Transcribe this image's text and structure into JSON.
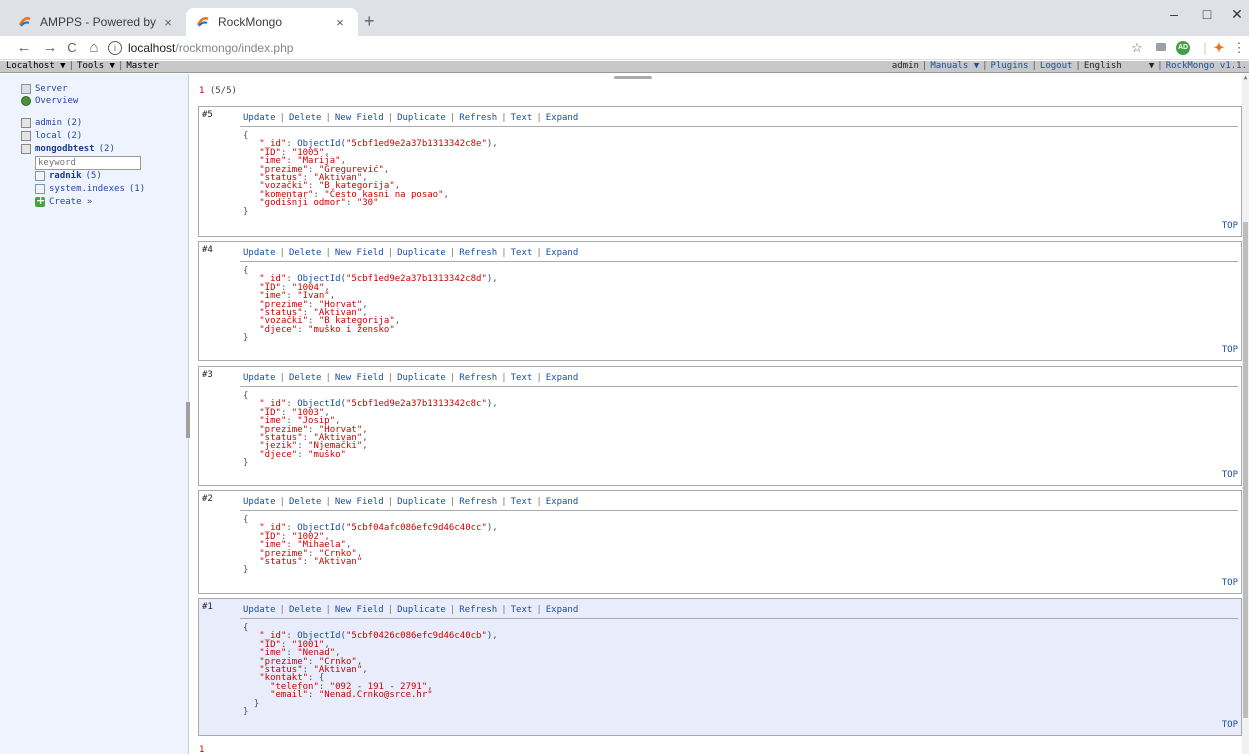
{
  "browser": {
    "tabs": [
      {
        "title": "AMPPS - Powered by Softaculous",
        "close": "×"
      },
      {
        "title": "RockMongo",
        "close": "×"
      }
    ],
    "new_tab": "+",
    "window": {
      "minimize": "–",
      "maximize": "□",
      "close": "✕"
    },
    "nav": {
      "back": "←",
      "forward": "→",
      "reload": "C",
      "home": "⌂"
    },
    "url_host": "localhost",
    "url_path": "/rockmongo/index.php",
    "info_icon": "i",
    "star": "☆",
    "menu": "⋮"
  },
  "topbar": {
    "host": "Localhost ▼",
    "tools": "Tools ▼",
    "master": "Master",
    "user": "admin",
    "manuals": "Manuals ▼",
    "plugins": "Plugins",
    "logout": "Logout",
    "language": "English",
    "lang_arrow": "▼",
    "version": "RockMongo v1.1."
  },
  "sidebar": {
    "server": "Server",
    "overview": "Overview",
    "databases": [
      {
        "name": "admin",
        "count": "(2)"
      },
      {
        "name": "local",
        "count": "(2)"
      },
      {
        "name": "mongodbtest",
        "count": "(2)"
      }
    ],
    "keyword_placeholder": "keyword",
    "collections": [
      {
        "name": "radnik",
        "count": "(5)"
      },
      {
        "name": "system.indexes",
        "count": "(1)"
      }
    ],
    "create": "Create »"
  },
  "main": {
    "page_current": "1",
    "page_info": "(5/5)",
    "page_bottom": "1",
    "ops": {
      "update": "Update",
      "delete": "Delete",
      "new_field": "New Field",
      "duplicate": "Duplicate",
      "refresh": "Refresh",
      "text": "Text",
      "expand": "Expand"
    },
    "top_label": "TOP",
    "documents": [
      {
        "num": "#5",
        "id": "5cbf1ed9e2a37b1313342c8e",
        "fields": [
          [
            "\"ID\"",
            "\"1005\""
          ],
          [
            "\"ime\"",
            "\"Marija\""
          ],
          [
            "\"prezime\"",
            "\"Gregurević\""
          ],
          [
            "\"status\"",
            "\"Aktivan\""
          ],
          [
            "\"vozački\"",
            "\"B kategorija\""
          ],
          [
            "\"komentar\"",
            "\"Često kasni na posao\""
          ],
          [
            "\"godišnji odmor\"",
            "\"30\""
          ]
        ]
      },
      {
        "num": "#4",
        "id": "5cbf1ed9e2a37b1313342c8d",
        "fields": [
          [
            "\"ID\"",
            "\"1004\""
          ],
          [
            "\"ime\"",
            "\"Ivan\""
          ],
          [
            "\"prezime\"",
            "\"Horvat\""
          ],
          [
            "\"status\"",
            "\"Aktivan\""
          ],
          [
            "\"vozački\"",
            "\"B kategorija\""
          ],
          [
            "\"djece\"",
            "\"muško i žensko\""
          ]
        ]
      },
      {
        "num": "#3",
        "id": "5cbf1ed9e2a37b1313342c8c",
        "fields": [
          [
            "\"ID\"",
            "\"1003\""
          ],
          [
            "\"ime\"",
            "\"Josip\""
          ],
          [
            "\"prezime\"",
            "\"Horvat\""
          ],
          [
            "\"status\"",
            "\"Aktivan\""
          ],
          [
            "\"jezik\"",
            "\"Njemački\""
          ],
          [
            "\"djece\"",
            "\"muško\""
          ]
        ]
      },
      {
        "num": "#2",
        "id": "5cbf04afc086efc9d46c40cc",
        "fields": [
          [
            "\"ID\"",
            "\"1002\""
          ],
          [
            "\"ime\"",
            "\"Mihaela\""
          ],
          [
            "\"prezime\"",
            "\"Crnko\""
          ],
          [
            "\"status\"",
            "\"Aktivan\""
          ]
        ]
      },
      {
        "num": "#1",
        "id": "5cbf0426c086efc9d46c40cb",
        "fields": [
          [
            "\"ID\"",
            "\"1001\""
          ],
          [
            "\"ime\"",
            "\"Nenad\""
          ],
          [
            "\"prezime\"",
            "\"Crnko\""
          ],
          [
            "\"status\"",
            "\"Aktivan\""
          ]
        ],
        "nested": {
          "key": "\"kontakt\"",
          "fields": [
            [
              "\"telefon\"",
              "\"092 - 191 - 2791\""
            ],
            [
              "\"email\"",
              "\"Nenad.Crnko@srce.hr\""
            ]
          ]
        }
      }
    ]
  },
  "colors": {
    "link": "#1a4fa0",
    "value": "#cc0000",
    "sidebar_bg": "#eef3fd",
    "highlight_row": "#e9ecfa"
  }
}
